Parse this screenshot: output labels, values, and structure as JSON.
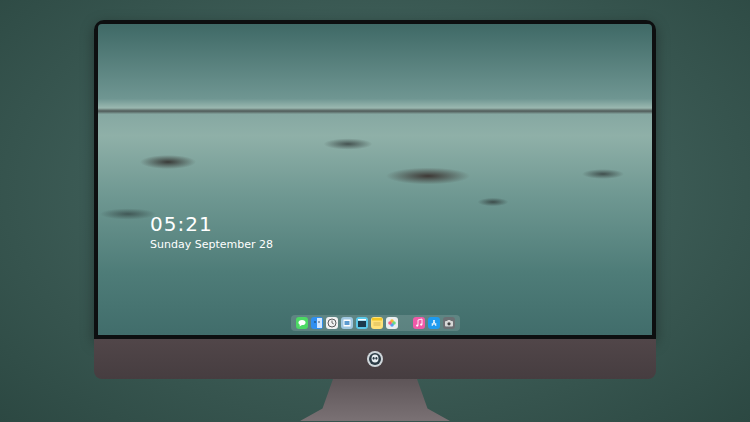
{
  "desktop": {
    "clock": {
      "time": "05:21",
      "date": "Sunday September 28"
    },
    "dock": {
      "items": [
        {
          "kind": "messages",
          "color": "#4cd964"
        },
        {
          "kind": "finder",
          "color": "#2f8ff0"
        },
        {
          "kind": "clock",
          "color": "#f2f2f2"
        },
        {
          "kind": "preview",
          "color": "#9fc7e0"
        },
        {
          "kind": "video",
          "color": "#5ac8e8"
        },
        {
          "kind": "notes",
          "color": "#ffe27a"
        },
        {
          "kind": "photos",
          "color": "#e9eef0"
        },
        {
          "kind": "music",
          "color": "#f05aa8"
        },
        {
          "kind": "store",
          "color": "#1e9bf0"
        },
        {
          "kind": "camera",
          "color": "#6b6f73"
        }
      ]
    }
  }
}
